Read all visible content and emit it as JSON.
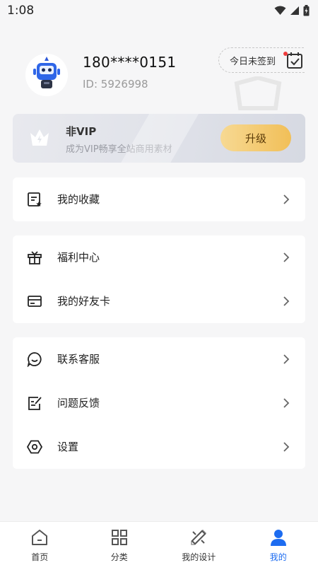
{
  "status_bar": {
    "time": "1:08"
  },
  "profile": {
    "username": "180****0151",
    "user_id": "ID: 5926998",
    "checkin_label": "今日未签到"
  },
  "vip": {
    "title": "非VIP",
    "subtitle": "成为VIP畅享全站商用素材",
    "button_label": "升级"
  },
  "menu_groups": [
    [
      {
        "label": "我的收藏",
        "icon": "favorites-icon"
      }
    ],
    [
      {
        "label": "福利中心",
        "icon": "gift-icon"
      },
      {
        "label": "我的好友卡",
        "icon": "card-icon"
      }
    ],
    [
      {
        "label": "联系客服",
        "icon": "chat-icon"
      },
      {
        "label": "问题反馈",
        "icon": "feedback-icon"
      },
      {
        "label": "设置",
        "icon": "settings-icon"
      }
    ]
  ],
  "tabbar": {
    "items": [
      {
        "label": "首页",
        "icon": "home-icon"
      },
      {
        "label": "分类",
        "icon": "grid-icon"
      },
      {
        "label": "我的设计",
        "icon": "design-icon"
      },
      {
        "label": "我的",
        "icon": "user-icon"
      }
    ],
    "active_index": 3,
    "active_color": "#1d6cf0",
    "inactive_color": "#333333"
  },
  "colors": {
    "background": "#f6f6f7",
    "vip_button": "#f1bf58",
    "accent": "#1d6cf0",
    "badge": "#ef3d3d"
  }
}
